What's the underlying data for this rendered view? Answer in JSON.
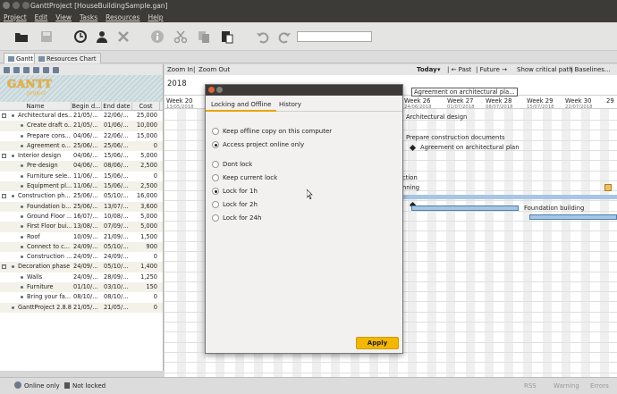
{
  "window": {
    "title": "GanttProject [HouseBuildingSample.gan]"
  },
  "menu": [
    "Project",
    "Edit",
    "View",
    "Tasks",
    "Resources",
    "Help"
  ],
  "toolbar": {
    "search_value": ""
  },
  "tabs": [
    {
      "label": "Gantt"
    },
    {
      "label": "Resources Chart"
    }
  ],
  "task_table": {
    "headers": [
      "Name",
      "Begin d...",
      "End date",
      "Cost"
    ],
    "rows": [
      {
        "name": "Architectural des...",
        "begin": "21/05/...",
        "end": "22/06/...",
        "cost": "25,000",
        "level": 0,
        "group": true
      },
      {
        "name": "Create draft o...",
        "begin": "21/05/...",
        "end": "01/06/...",
        "cost": "10,000",
        "level": 1,
        "group": false
      },
      {
        "name": "Prepare cons...",
        "begin": "04/06/...",
        "end": "22/06/...",
        "cost": "15,000",
        "level": 1,
        "group": false
      },
      {
        "name": "Agreement o...",
        "begin": "25/06/...",
        "end": "25/06/...",
        "cost": "0",
        "level": 1,
        "group": false
      },
      {
        "name": "Interior design",
        "begin": "04/06/...",
        "end": "15/06/...",
        "cost": "5,000",
        "level": 0,
        "group": true
      },
      {
        "name": "Pre-design",
        "begin": "04/06/...",
        "end": "08/06/...",
        "cost": "2,500",
        "level": 1,
        "group": false
      },
      {
        "name": "Furniture sele...",
        "begin": "11/06/...",
        "end": "15/06/...",
        "cost": "0",
        "level": 1,
        "group": false
      },
      {
        "name": "Equipment pl...",
        "begin": "11/06/...",
        "end": "15/06/...",
        "cost": "2,500",
        "level": 1,
        "group": false
      },
      {
        "name": "Construction ph...",
        "begin": "25/06/...",
        "end": "05/10/...",
        "cost": "16,000",
        "level": 0,
        "group": true
      },
      {
        "name": "Foundation b...",
        "begin": "25/06/...",
        "end": "13/07/...",
        "cost": "3,600",
        "level": 1,
        "group": false
      },
      {
        "name": "Ground Floor ...",
        "begin": "16/07/...",
        "end": "10/08/...",
        "cost": "5,000",
        "level": 1,
        "group": false
      },
      {
        "name": "First Floor bui...",
        "begin": "13/08/...",
        "end": "07/09/...",
        "cost": "5,000",
        "level": 1,
        "group": false
      },
      {
        "name": "Roof",
        "begin": "10/09/...",
        "end": "21/09/...",
        "cost": "1,500",
        "level": 1,
        "group": false
      },
      {
        "name": "Connect to c...",
        "begin": "24/09/...",
        "end": "05/10/...",
        "cost": "900",
        "level": 1,
        "group": false
      },
      {
        "name": "Construction ...",
        "begin": "24/09/...",
        "end": "24/09/...",
        "cost": "0",
        "level": 1,
        "group": false
      },
      {
        "name": "Decoration phase",
        "begin": "24/09/...",
        "end": "05/10/...",
        "cost": "1,400",
        "level": 0,
        "group": true
      },
      {
        "name": "Walls",
        "begin": "24/09/...",
        "end": "28/09/...",
        "cost": "1,250",
        "level": 1,
        "group": false
      },
      {
        "name": "Furniture",
        "begin": "01/10/...",
        "end": "03/10/...",
        "cost": "150",
        "level": 1,
        "group": false
      },
      {
        "name": "Bring your fa...",
        "begin": "08/10/...",
        "end": "08/10/...",
        "cost": "0",
        "level": 1,
        "group": false
      },
      {
        "name": "GanttProject 2.8.8",
        "begin": "21/05/...",
        "end": "21/05/...",
        "cost": "0",
        "level": 0,
        "group": false
      }
    ]
  },
  "logo": {
    "main": "GANTT",
    "sub": "project"
  },
  "chart_toolbar": {
    "zoom_in": "Zoom In",
    "separator": "|",
    "zoom_out": "Zoom Out",
    "today": "Today",
    "today_arrow": "▾",
    "past": "| ← Past",
    "future": "| Future →",
    "critical_path": "Show critical path",
    "baselines": "| Baselines..."
  },
  "timeline": {
    "year": "2018",
    "weeks": [
      {
        "label": "Week 20",
        "date": "13/05/2018"
      },
      {
        "label": "Week 26",
        "date": "24/06/2018"
      },
      {
        "label": "Week 27",
        "date": "01/07/2018"
      },
      {
        "label": "Week 28",
        "date": "08/07/2018"
      },
      {
        "label": "Week 29",
        "date": "15/07/2018"
      },
      {
        "label": "Week 30",
        "date": "22/07/2018"
      },
      {
        "label": "29",
        "date": ""
      }
    ]
  },
  "chart_labels": {
    "agreement_top": "Agreement on architectural pla...",
    "arch_design": "Architectural design",
    "prepare_docs": "Prepare construction documents",
    "agreement_plan": "Agreement on architectural plan",
    "ction": "ction",
    "nning": "nning",
    "foundation": "Foundation building"
  },
  "dialog": {
    "tabs": [
      "Locking and Offline",
      "History"
    ],
    "active_tab": 0,
    "group1": [
      {
        "label": "Keep offline copy on this computer",
        "checked": false
      },
      {
        "label": "Access project online only",
        "checked": true
      }
    ],
    "group2": [
      {
        "label": "Dont lock",
        "checked": false
      },
      {
        "label": "Keep current lock",
        "checked": false
      },
      {
        "label": "Lock for 1h",
        "checked": true
      },
      {
        "label": "Lock for 2h",
        "checked": false
      },
      {
        "label": "Lock for 24h",
        "checked": false
      }
    ],
    "apply_label": "Apply"
  },
  "status": {
    "online": "Online only",
    "lock": "Not locked",
    "rss": "RSS",
    "warning": "Warning",
    "errors": "Errors"
  },
  "colors": {
    "accent": "#f4b700",
    "bar_fill": "#a7c6e4",
    "bar_border": "#4e7fb1",
    "titlebar": "#3c3b37"
  }
}
